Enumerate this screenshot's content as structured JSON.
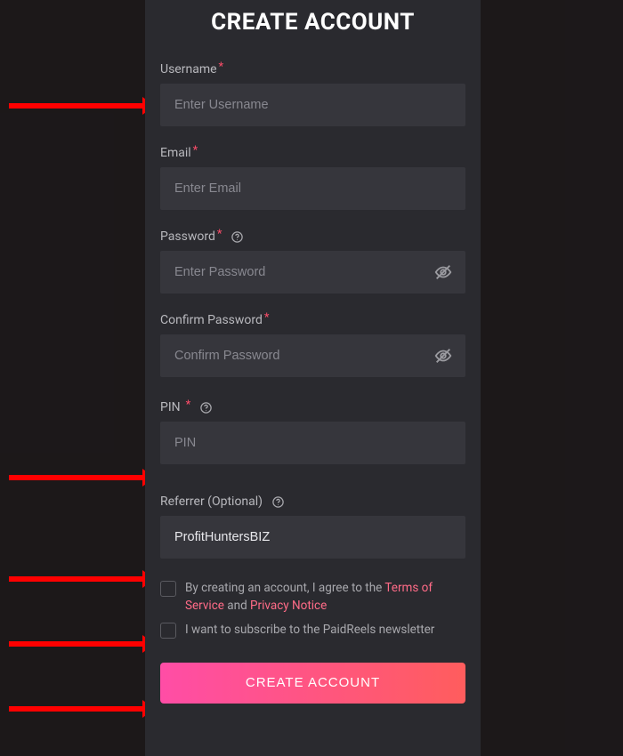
{
  "title": "CREATE ACCOUNT",
  "fields": {
    "username": {
      "label": "Username",
      "placeholder": "Enter Username",
      "required": true,
      "value": ""
    },
    "email": {
      "label": "Email",
      "placeholder": "Enter Email",
      "required": true,
      "value": ""
    },
    "password": {
      "label": "Password",
      "placeholder": "Enter Password",
      "required": true,
      "value": ""
    },
    "confirm": {
      "label": "Confirm Password",
      "placeholder": "Confirm Password",
      "required": true,
      "value": ""
    },
    "pin": {
      "label": "PIN",
      "placeholder": "PIN",
      "required": true,
      "value": ""
    },
    "referrer": {
      "label": "Referrer (Optional)",
      "placeholder": "",
      "required": false,
      "value": "ProfitHuntersBIZ"
    }
  },
  "agreements": {
    "terms": {
      "prefix": "By creating an account, I agree to the ",
      "terms_link": "Terms of Service",
      "joiner": "  and  ",
      "privacy_link": "Privacy Notice",
      "checked": false
    },
    "newsletter": {
      "text": "I want to subscribe to the PaidReels newsletter",
      "checked": false
    }
  },
  "submit": {
    "label": "CREATE ACCOUNT"
  },
  "asterisk": "*"
}
